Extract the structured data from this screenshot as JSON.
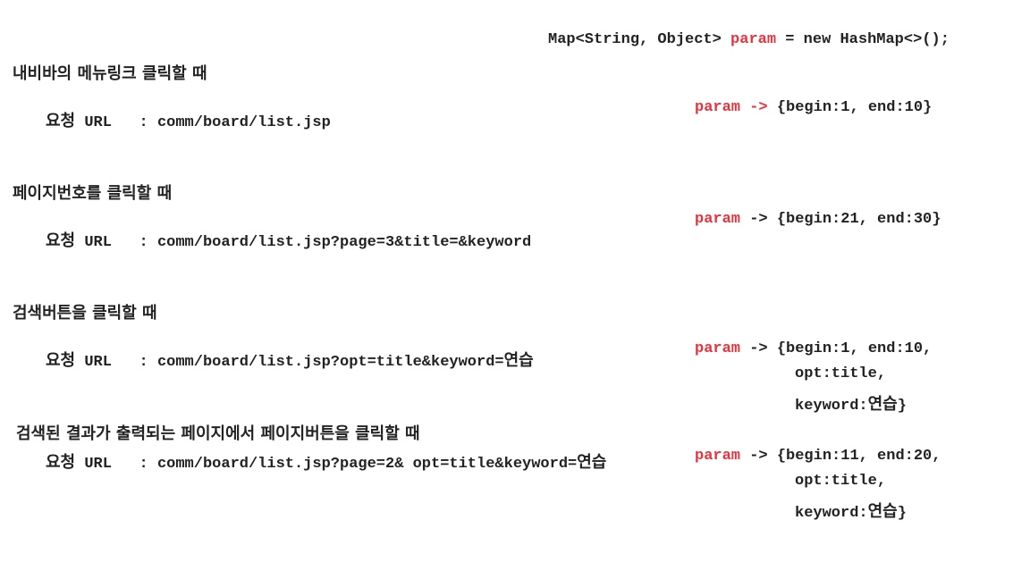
{
  "header": {
    "decl_prefix": "Map<String, Object> ",
    "decl_var": "param",
    "decl_suffix": " = new HashMap<>();"
  },
  "cases": [
    {
      "title": "내비바의 메뉴링크 클릭할 때",
      "req_label": "요청",
      "req_url_label": "URL",
      "req_sep": ":",
      "req_value": "comm/board/list.jsp",
      "param_var": "param",
      "param_arrow": "->",
      "param_line1": "{begin:1, end:10}"
    },
    {
      "title": "페이지번호를 클릭할 때",
      "req_label": "요청",
      "req_url_label": "URL",
      "req_sep": ":",
      "req_value": "comm/board/list.jsp?page=3&title=&keyword",
      "param_var": "param",
      "param_arrow": "->",
      "param_line1": "{begin:21, end:30}"
    },
    {
      "title": "검색버튼을 클릭할 때",
      "req_label": "요청",
      "req_url_label": "URL",
      "req_sep": ":",
      "req_value_prefix": "comm/board/list.jsp?opt=title&keyword=",
      "req_value_korean": "연습",
      "param_var": "param",
      "param_arrow": "->",
      "param_line1": "{begin:1, end:10,",
      "param_line2": "opt:title,",
      "param_line3_prefix": "keyword:",
      "param_line3_korean": "연습",
      "param_line3_suffix": "}"
    },
    {
      "title": "검색된 결과가 출력되는 페이지에서 페이지버튼을 클릭할 때",
      "req_label": "요청",
      "req_url_label": "URL",
      "req_sep": ":",
      "req_value_prefix": "comm/board/list.jsp?page=2& opt=title&keyword=",
      "req_value_korean": "연습",
      "param_var": "param",
      "param_arrow": "->",
      "param_line1": "{begin:11, end:20,",
      "param_line2": "opt:title,",
      "param_line3_prefix": "keyword:",
      "param_line3_korean": "연습",
      "param_line3_suffix": "}"
    }
  ]
}
